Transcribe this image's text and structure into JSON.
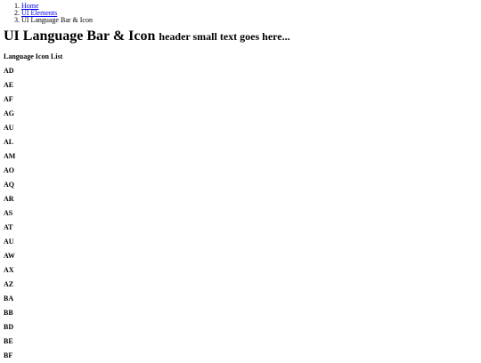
{
  "breadcrumb": {
    "items": [
      "Home",
      "UI Elements",
      "UI Language Bar & Icon"
    ]
  },
  "header": {
    "title": "UI Language Bar & Icon",
    "subtitle": "header small text goes here..."
  },
  "section": {
    "title": "Language Icon List"
  },
  "languages": [
    "AD",
    "AE",
    "AF",
    "AG",
    "AU",
    "AL",
    "AM",
    "AO",
    "AQ",
    "AR",
    "AS",
    "AT",
    "AU",
    "AW",
    "AX",
    "AZ",
    "BA",
    "BB",
    "BD",
    "BE",
    "BF"
  ]
}
